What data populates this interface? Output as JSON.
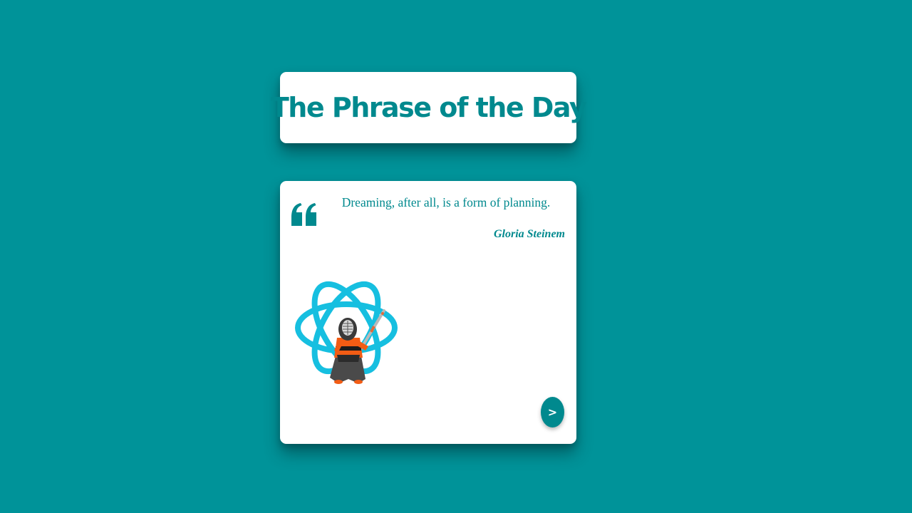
{
  "page": {
    "title": "The Phrase of the Day"
  },
  "quote": {
    "text": "Dreaming, after all, is a form of planning.",
    "author": "Gloria Steinem",
    "mark_icon": "quote-icon"
  },
  "illustration": {
    "icon": "react-atom-kendo-fighter"
  },
  "next_button": {
    "label": ">"
  },
  "colors": {
    "background": "#009399",
    "accent": "#00898e",
    "card": "#ffffff",
    "atom": "#16bfe0",
    "fighter_orange": "#f25c14"
  }
}
